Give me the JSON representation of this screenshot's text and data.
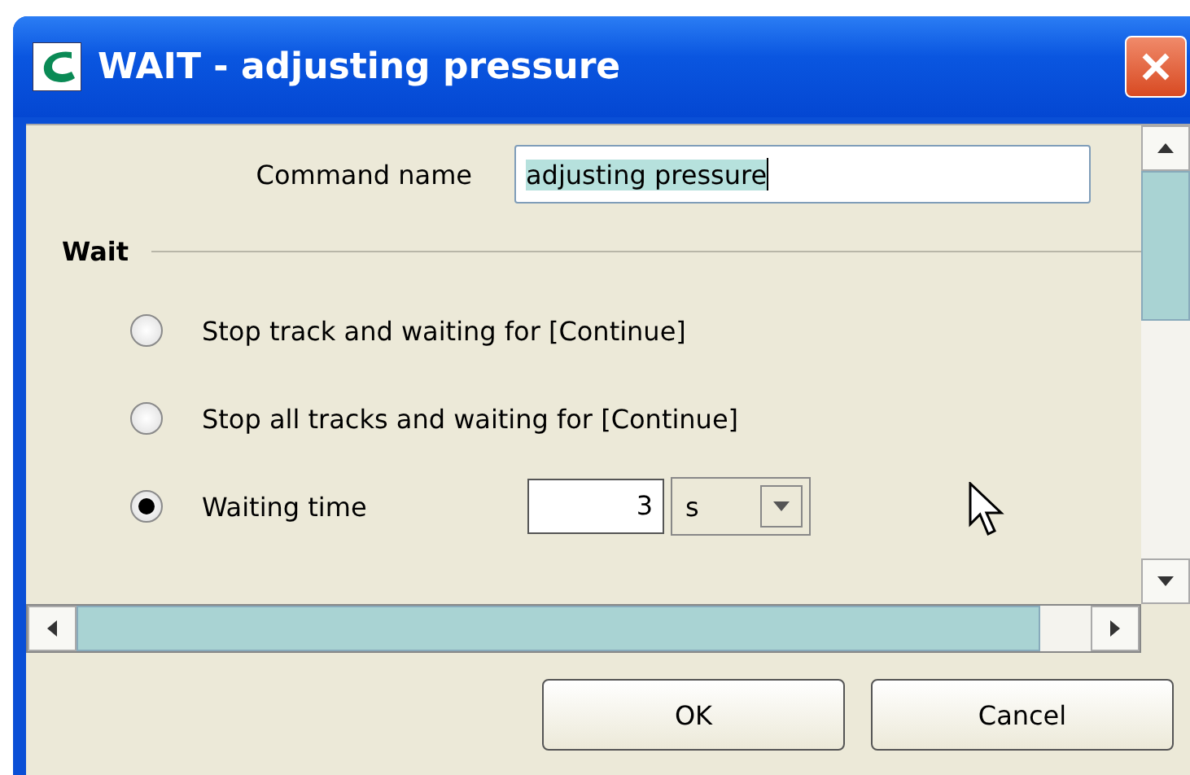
{
  "window": {
    "title": "WAIT - adjusting pressure"
  },
  "command_name": {
    "label": "Command name",
    "value": "adjusting pressure",
    "selected_text": true
  },
  "section": {
    "title": "Wait"
  },
  "options": [
    {
      "label": "Stop track and waiting for [Continue]",
      "selected": false
    },
    {
      "label": "Stop all tracks and waiting for [Continue]",
      "selected": false
    },
    {
      "label": "Waiting time",
      "selected": true
    }
  ],
  "waiting_time": {
    "value": "3",
    "unit": "s"
  },
  "buttons": [
    "OK",
    "Cancel"
  ]
}
